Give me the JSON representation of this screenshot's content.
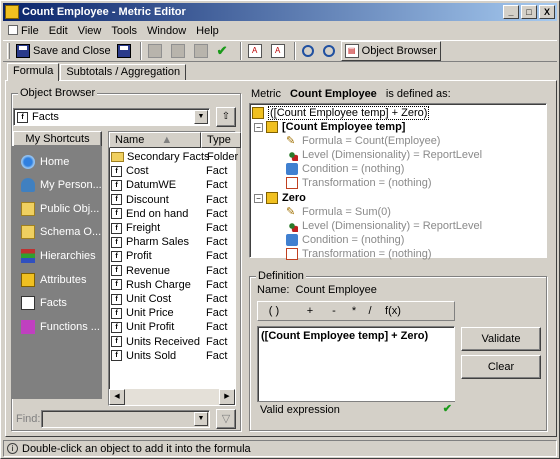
{
  "window": {
    "title": "Count Employee - Metric Editor",
    "buttons": [
      "_",
      "□",
      "X"
    ]
  },
  "menubar": [
    "File",
    "Edit",
    "View",
    "Tools",
    "Window",
    "Help"
  ],
  "toolbar": {
    "save_close": "Save and Close",
    "object_browser": "Object Browser"
  },
  "tabs": [
    "Formula",
    "Subtotals / Aggregation"
  ],
  "object_browser": {
    "label": "Object Browser",
    "folder": "Facts",
    "shortcuts_header": "My Shortcuts",
    "shortcuts": [
      "Home",
      "My Person...",
      "Public Obj...",
      "Schema O...",
      "Hierarchies",
      "Attributes",
      "Facts",
      "Functions ..."
    ],
    "columns": [
      "Name",
      "Type"
    ],
    "items": [
      {
        "name": "Secondary Facts",
        "type": "Folder"
      },
      {
        "name": "Cost",
        "type": "Fact"
      },
      {
        "name": "DatumWE",
        "type": "Fact"
      },
      {
        "name": "Discount",
        "type": "Fact"
      },
      {
        "name": "End on hand",
        "type": "Fact"
      },
      {
        "name": "Freight",
        "type": "Fact"
      },
      {
        "name": "Pharm Sales",
        "type": "Fact"
      },
      {
        "name": "Profit",
        "type": "Fact"
      },
      {
        "name": "Revenue",
        "type": "Fact"
      },
      {
        "name": "Rush Charge",
        "type": "Fact"
      },
      {
        "name": "Unit Cost",
        "type": "Fact"
      },
      {
        "name": "Unit Price",
        "type": "Fact"
      },
      {
        "name": "Unit Profit",
        "type": "Fact"
      },
      {
        "name": "Units Received",
        "type": "Fact"
      },
      {
        "name": "Units Sold",
        "type": "Fact"
      }
    ],
    "find_label": "Find:"
  },
  "metric_header": {
    "prefix": "Metric",
    "name": "Count Employee",
    "suffix": "is defined as:"
  },
  "tree": {
    "root": "([Count Employee temp] + Zero)",
    "nodes": [
      {
        "name": "[Count Employee temp]",
        "children": [
          "Formula = Count(Employee)",
          "Level (Dimensionality) = ReportLevel",
          "Condition = (nothing)",
          "Transformation = (nothing)"
        ]
      },
      {
        "name": "Zero",
        "children": [
          "Formula = Sum(0)",
          "Level (Dimensionality) = ReportLevel",
          "Condition = (nothing)",
          "Transformation = (nothing)"
        ]
      }
    ]
  },
  "definition": {
    "label": "Definition",
    "name_label": "Name:",
    "name_value": "Count Employee",
    "operators": [
      "( )",
      "+",
      "-",
      "*",
      "/",
      "f(x)"
    ],
    "expression": "([Count Employee temp] + Zero)",
    "status": "Valid expression",
    "validate": "Validate",
    "clear": "Clear"
  },
  "statusbar": "Double-click an object to add it into the formula"
}
